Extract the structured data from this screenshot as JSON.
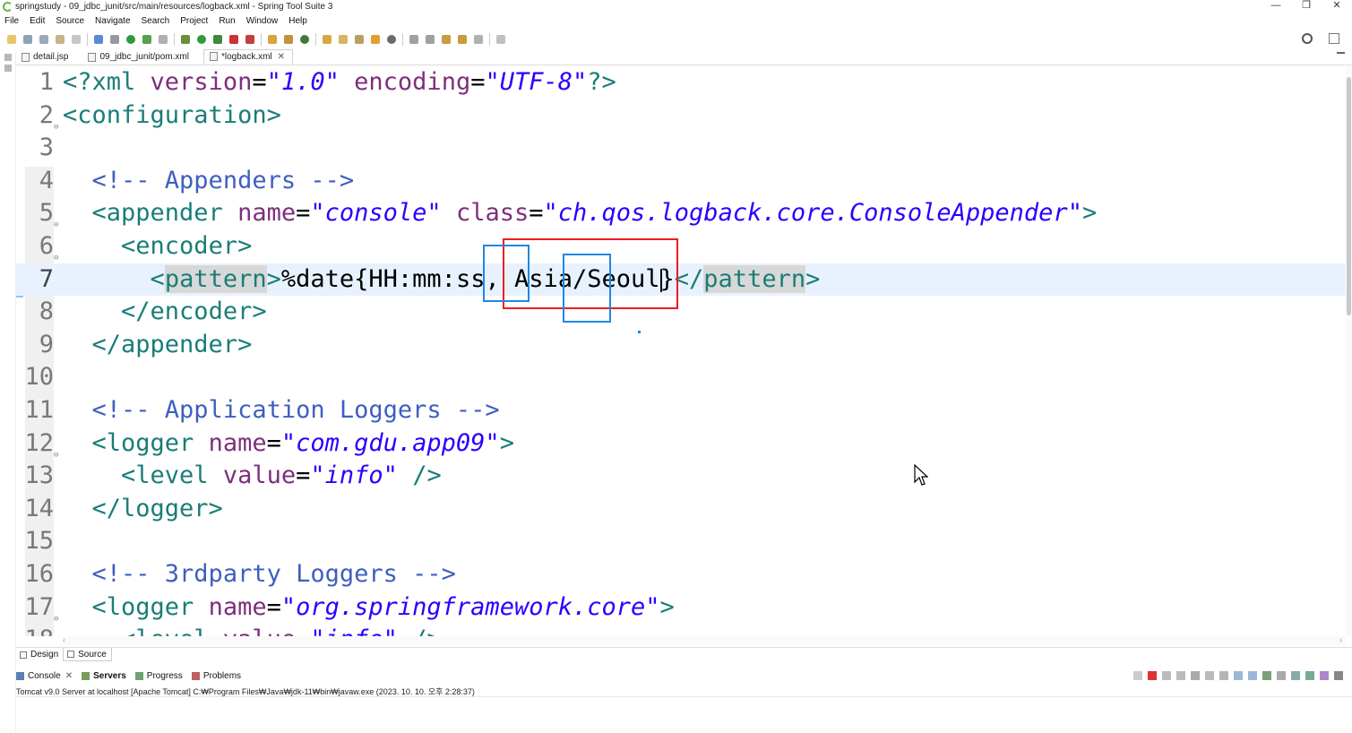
{
  "window": {
    "title": "springstudy - 09_jdbc_junit/src/main/resources/logback.xml - Spring Tool Suite 3",
    "controls": [
      "—",
      "❐",
      "✕"
    ]
  },
  "menu": [
    "File",
    "Edit",
    "Source",
    "Navigate",
    "Search",
    "Project",
    "Run",
    "Window",
    "Help"
  ],
  "tabs": [
    {
      "label": "detail.jsp",
      "active": false
    },
    {
      "label": "09_jdbc_junit/pom.xml",
      "active": false
    },
    {
      "label": "*logback.xml",
      "active": true,
      "close": "✕"
    }
  ],
  "editor": {
    "lines": [
      {
        "n": "1",
        "fold": "",
        "tokens": [
          [
            "t-tag",
            "<?xml "
          ],
          [
            "t-attr",
            "version"
          ],
          [
            "t-eq",
            "="
          ],
          [
            "t-val",
            "\"1.0\""
          ],
          [
            "t-txt",
            " "
          ],
          [
            "t-attr",
            "encoding"
          ],
          [
            "t-eq",
            "="
          ],
          [
            "t-val",
            "\"UTF-8\""
          ],
          [
            "t-tag",
            "?>"
          ]
        ]
      },
      {
        "n": "2",
        "fold": "⊖",
        "tokens": [
          [
            "t-tag",
            "<configuration>"
          ]
        ]
      },
      {
        "n": "3",
        "fold": "",
        "tokens": []
      },
      {
        "n": "4",
        "fold": "",
        "tokens": [
          [
            "t-txt",
            "  "
          ],
          [
            "t-com",
            "<!-- Appenders -->"
          ]
        ]
      },
      {
        "n": "5",
        "fold": "⊖",
        "tokens": [
          [
            "t-txt",
            "  "
          ],
          [
            "t-tag",
            "<appender "
          ],
          [
            "t-attr",
            "name"
          ],
          [
            "t-eq",
            "="
          ],
          [
            "t-val",
            "\"console\""
          ],
          [
            "t-txt",
            " "
          ],
          [
            "t-attr",
            "class"
          ],
          [
            "t-eq",
            "="
          ],
          [
            "t-val",
            "\"ch.qos.logback.core.ConsoleAppender\""
          ],
          [
            "t-tag",
            ">"
          ]
        ]
      },
      {
        "n": "6",
        "fold": "⊖",
        "tokens": [
          [
            "t-txt",
            "    "
          ],
          [
            "t-tag",
            "<encoder>"
          ]
        ]
      },
      {
        "n": "7",
        "fold": "",
        "current": true,
        "tokens": [
          [
            "t-txt",
            "      "
          ],
          [
            "t-tag",
            "<"
          ],
          [
            "t-el match-box",
            "pattern"
          ],
          [
            "t-tag",
            ">"
          ],
          [
            "t-txt",
            "%date{HH:mm:ss, Asia/Seoul}"
          ],
          [
            "t-tag",
            "</"
          ],
          [
            "t-el match-box",
            "pattern"
          ],
          [
            "t-tag",
            ">"
          ]
        ]
      },
      {
        "n": "8",
        "fold": "",
        "tokens": [
          [
            "t-txt",
            "    "
          ],
          [
            "t-tag",
            "</encoder>"
          ]
        ]
      },
      {
        "n": "9",
        "fold": "",
        "tokens": [
          [
            "t-txt",
            "  "
          ],
          [
            "t-tag",
            "</appender>"
          ]
        ]
      },
      {
        "n": "10",
        "fold": "",
        "tokens": []
      },
      {
        "n": "11",
        "fold": "",
        "tokens": [
          [
            "t-txt",
            "  "
          ],
          [
            "t-com",
            "<!-- Application Loggers -->"
          ]
        ]
      },
      {
        "n": "12",
        "fold": "⊖",
        "tokens": [
          [
            "t-txt",
            "  "
          ],
          [
            "t-tag",
            "<logger "
          ],
          [
            "t-attr",
            "name"
          ],
          [
            "t-eq",
            "="
          ],
          [
            "t-val",
            "\"com.gdu.app09\""
          ],
          [
            "t-tag",
            ">"
          ]
        ]
      },
      {
        "n": "13",
        "fold": "",
        "tokens": [
          [
            "t-txt",
            "    "
          ],
          [
            "t-tag",
            "<level "
          ],
          [
            "t-attr",
            "value"
          ],
          [
            "t-eq",
            "="
          ],
          [
            "t-val",
            "\"info\""
          ],
          [
            "t-txt",
            " "
          ],
          [
            "t-tag",
            "/>"
          ]
        ]
      },
      {
        "n": "14",
        "fold": "",
        "tokens": [
          [
            "t-txt",
            "  "
          ],
          [
            "t-tag",
            "</logger>"
          ]
        ]
      },
      {
        "n": "15",
        "fold": "",
        "tokens": []
      },
      {
        "n": "16",
        "fold": "",
        "tokens": [
          [
            "t-txt",
            "  "
          ],
          [
            "t-com",
            "<!-- 3rdparty Loggers -->"
          ]
        ]
      },
      {
        "n": "17",
        "fold": "⊖",
        "tokens": [
          [
            "t-txt",
            "  "
          ],
          [
            "t-tag",
            "<logger "
          ],
          [
            "t-attr",
            "name"
          ],
          [
            "t-eq",
            "="
          ],
          [
            "t-val",
            "\"org.springframework.core\""
          ],
          [
            "t-tag",
            ">"
          ]
        ]
      },
      {
        "n": "18",
        "fold": "",
        "tokens": [
          [
            "t-txt",
            "    "
          ],
          [
            "t-tag",
            "<level "
          ],
          [
            "t-attr",
            "value"
          ],
          [
            "t-eq",
            "="
          ],
          [
            "t-val",
            "\"info\""
          ],
          [
            "t-txt",
            " "
          ],
          [
            "t-tag",
            "/>"
          ]
        ]
      }
    ]
  },
  "editor_tabs": [
    {
      "label": "Design",
      "active": false
    },
    {
      "label": "Source",
      "active": true
    }
  ],
  "bottom_panel": {
    "tabs": [
      {
        "label": "Console",
        "bold": false,
        "close": "✕",
        "icon": "console-icon"
      },
      {
        "label": "Servers",
        "bold": true,
        "icon": "servers-icon"
      },
      {
        "label": "Progress",
        "bold": false,
        "icon": "progress-icon"
      },
      {
        "label": "Problems",
        "bold": false,
        "icon": "problems-icon"
      }
    ],
    "console_status": "Tomcat v9.0 Server at localhost [Apache Tomcat] C:₩Program Files₩Java₩jdk-11₩bin₩javaw.exe  (2023. 10. 10. 오후 2:28:37)"
  },
  "colors": {
    "tag": "#1a7d78",
    "attr": "#7d2f7a",
    "value": "#2a00ff",
    "comment": "#3f5fbf",
    "annotation_red": "#ee1c1c",
    "annotation_blue": "#1e88e5"
  }
}
